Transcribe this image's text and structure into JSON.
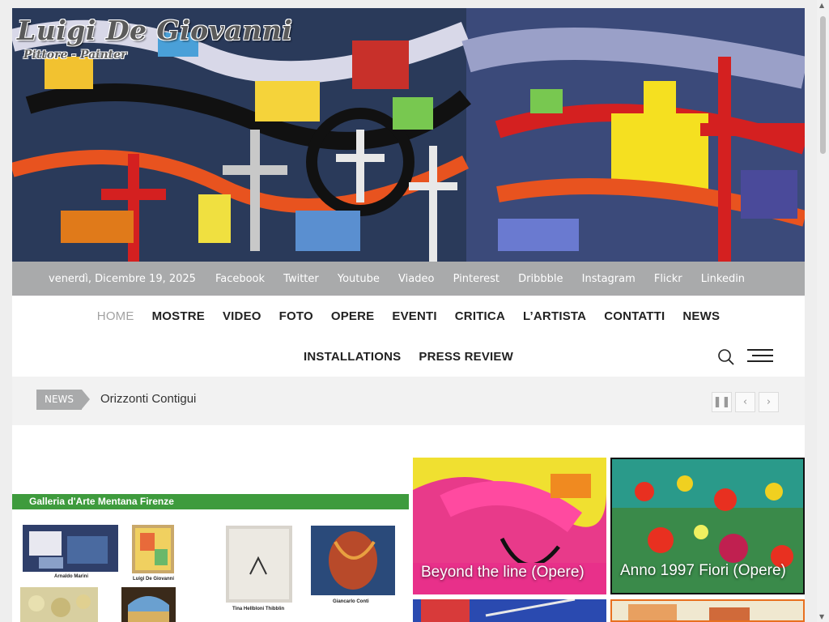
{
  "site": {
    "title": "Luigi De Giovanni",
    "subtitle": "Pittore - Painter"
  },
  "topbar": {
    "date": "venerdì, Dicembre 19, 2025",
    "social": [
      "Facebook",
      "Twitter",
      "Youtube",
      "Viadeo",
      "Pinterest",
      "Dribbble",
      "Instagram",
      "Flickr",
      "Linkedin"
    ]
  },
  "nav": {
    "row1": [
      "HOME",
      "MOSTRE",
      "VIDEO",
      "FOTO",
      "OPERE",
      "EVENTI",
      "CRITICA",
      "L’ARTISTA",
      "CONTATTI",
      "NEWS"
    ],
    "row2": [
      "INSTALLATIONS",
      "PRESS REVIEW"
    ],
    "active": "HOME",
    "search_icon": "search-icon",
    "menu_icon": "hamburger-menu-icon"
  },
  "ticker": {
    "badge": "NEWS",
    "headline": "Orizzonti Contigui",
    "controls": [
      "pause-icon",
      "chevron-left-icon",
      "chevron-right-icon"
    ],
    "pause_glyph": "❚❚",
    "prev_glyph": "‹",
    "next_glyph": "›"
  },
  "gallery": {
    "banner": "Galleria d'Arte Mentana Firenze",
    "captions": [
      "Arnaldo Marini",
      "Luigi De Giovanni",
      "Tina Hellbloni Thibblin",
      "Giancarlo Conti"
    ]
  },
  "cards": [
    {
      "title": "Beyond the line (Opere)"
    },
    {
      "title": "Anno 1997 Fiori (Opere)"
    }
  ],
  "colors": {
    "topbar": "#a9aaab",
    "gallery_banner": "#3e9b3d",
    "active_nav": "#a2a2a2"
  }
}
